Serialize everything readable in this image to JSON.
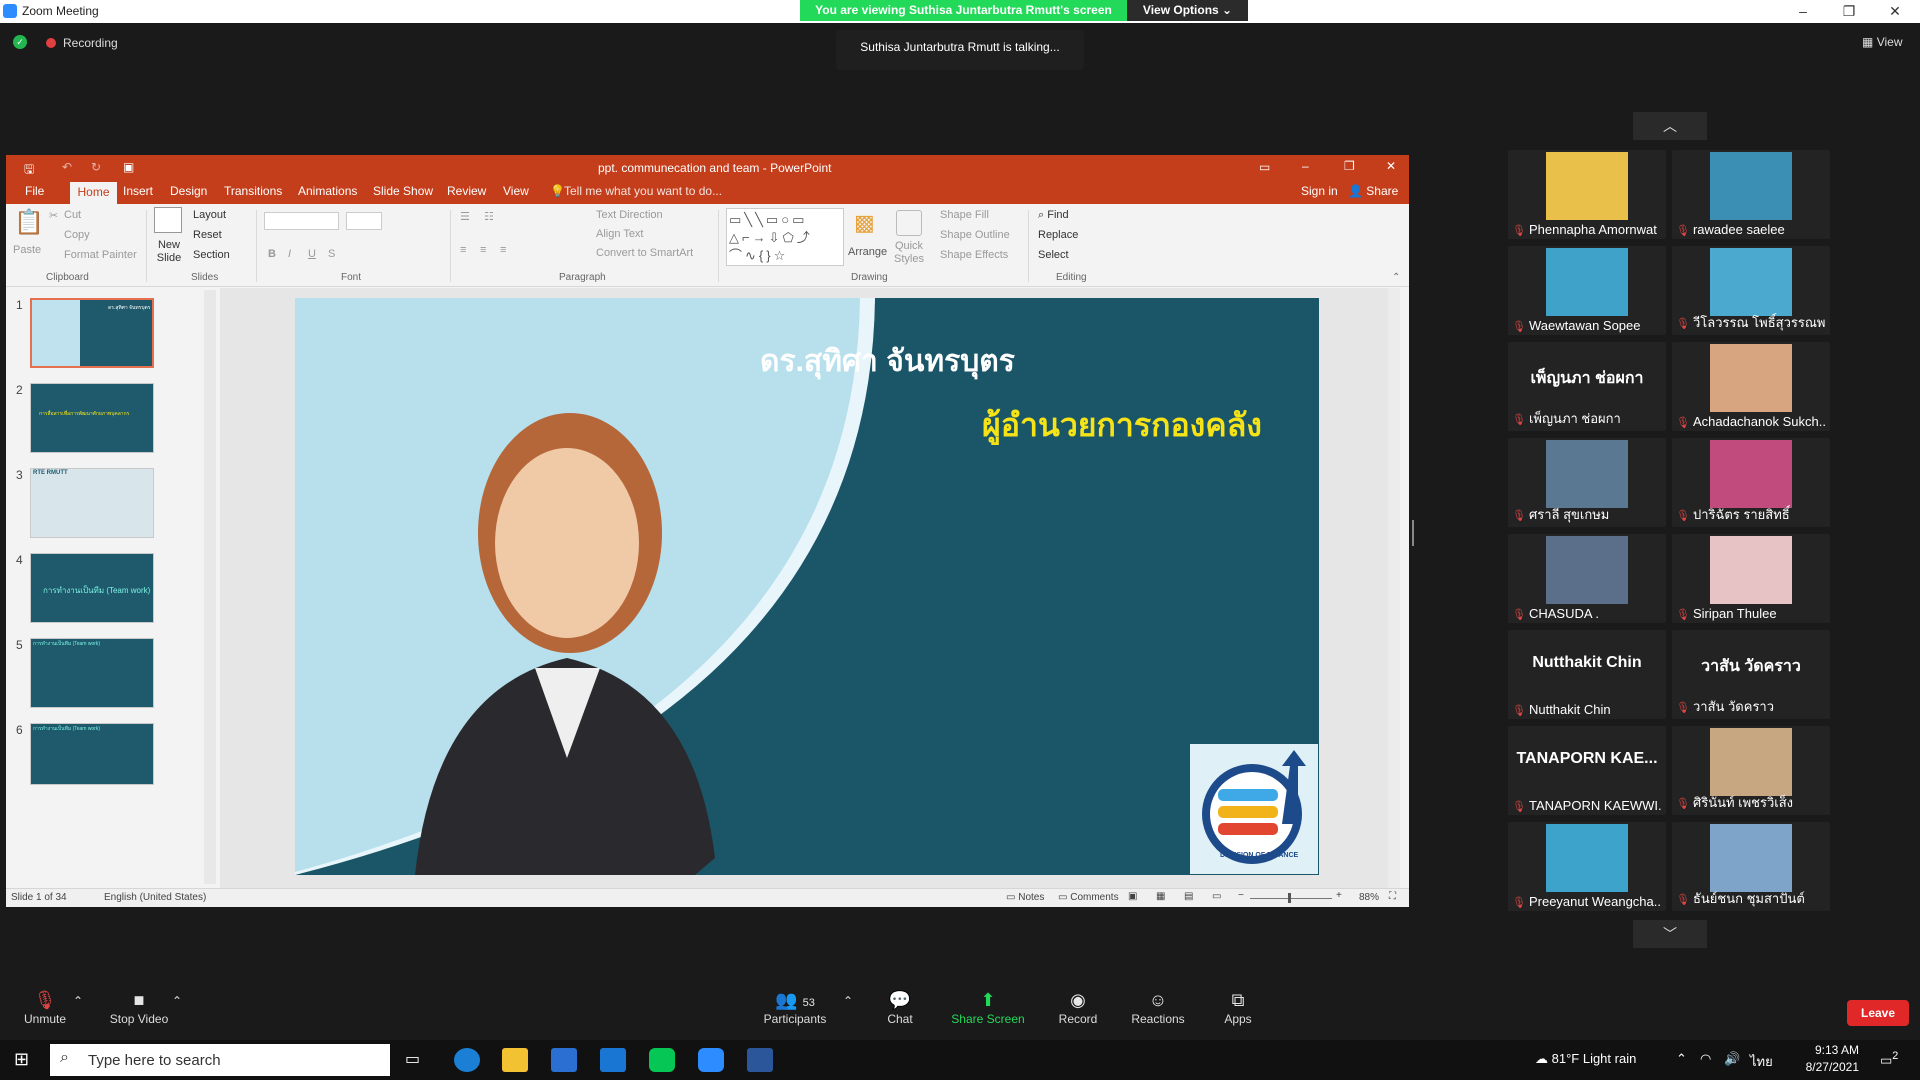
{
  "window": {
    "title": "Zoom Meeting"
  },
  "banner": {
    "viewing": "You are viewing Suthisa  Juntarbutra Rmutt's screen",
    "view_options": "View Options"
  },
  "talking": "Suthisa  Juntarbutra Rmutt is talking...",
  "recording": "Recording",
  "view_label": "View",
  "ppt": {
    "title": "ppt. communecation and team  -  PowerPoint",
    "tabs": [
      "File",
      "Home",
      "Insert",
      "Design",
      "Transitions",
      "Animations",
      "Slide Show",
      "Review",
      "View"
    ],
    "tell_me": "Tell me what you want to do...",
    "sign_in": "Sign in",
    "share": "Share",
    "ribbon": {
      "paste": "Paste",
      "cut": "Cut",
      "copy": "Copy",
      "format_painter": "Format Painter",
      "clipboard": "Clipboard",
      "new_slide": "New Slide",
      "layout": "Layout",
      "reset": "Reset",
      "section": "Section",
      "slides": "Slides",
      "font": "Font",
      "paragraph": "Paragraph",
      "text_direction": "Text Direction",
      "align_text": "Align Text",
      "convert_smartart": "Convert to SmartArt",
      "arrange": "Arrange",
      "quick_styles": "Quick Styles",
      "shape_fill": "Shape Fill",
      "shape_outline": "Shape Outline",
      "shape_effects": "Shape Effects",
      "drawing": "Drawing",
      "find": "Find",
      "replace": "Replace",
      "select": "Select",
      "editing": "Editing"
    },
    "thumbnails": [
      {
        "num": "1",
        "text": "ดร.สุทิศา จันทรบุตร"
      },
      {
        "num": "2",
        "text": "การสื่อสารเพื่อการพัฒนาศักยภาพบุคลากร"
      },
      {
        "num": "3",
        "text": "RTE RMUTT"
      },
      {
        "num": "4",
        "text": "การทำงานเป็นทีม (Team work)"
      },
      {
        "num": "5",
        "text": "การทำงานเป็นทีม (Team work)"
      },
      {
        "num": "6",
        "text": "การทำงานเป็นทีม (Team work)"
      }
    ],
    "slide": {
      "title": "ดร.สุทิศา  จันทรบุตร",
      "subtitle": "ผู้อำนวยการกองคลัง",
      "logo_text": "DEVISION OF FINANCE"
    },
    "status": {
      "slide_of": "Slide 1 of 34",
      "language": "English (United States)",
      "notes": "Notes",
      "comments": "Comments",
      "zoom": "88%"
    }
  },
  "gallery": [
    {
      "name": "Phennapha Amornwat",
      "video": true,
      "bg": "#e9c14a"
    },
    {
      "name": "rawadee saelee",
      "video": true,
      "bg": "#3b8fb5"
    },
    {
      "name": "Waewtawan Sopee",
      "video": true,
      "bg": "#3fa2c8"
    },
    {
      "name": "วีโลวรรณ โพธิ์สุวรรณพร",
      "video": true,
      "bg": "#4ba9cf"
    },
    {
      "name": "เพ็ญนภา ช่อผกา",
      "big": "เพ็ญนภา ช่อผกา",
      "video": false
    },
    {
      "name": "Achadachanok  Sukch...",
      "video": true,
      "bg": "#d7a57f"
    },
    {
      "name": "ศราลี  สุขเกษม",
      "video": true,
      "bg": "#5a7892"
    },
    {
      "name": "ปาริฉัตร  รายสิทธิ์",
      "video": true,
      "bg": "#c24b7e"
    },
    {
      "name": "CHASUDA .",
      "video": true,
      "bg": "#5b6e8a"
    },
    {
      "name": "Siripan Thulee",
      "video": true,
      "bg": "#e7c3c6"
    },
    {
      "name": "Nutthakit Chin",
      "big": "Nutthakit Chin",
      "video": false
    },
    {
      "name": "วาสัน  วัดคราว",
      "big": "วาสัน  วัดคราว",
      "video": false
    },
    {
      "name": "TANAPORN KAEWWI...",
      "big": "TANAPORN  KAE...",
      "video": false
    },
    {
      "name": "ศิรินันท์ เพชรวิเส็ง",
      "video": true,
      "bg": "#c7a782"
    },
    {
      "name": "Preeyanut Weangcha...",
      "video": true,
      "bg": "#3ea3cb"
    },
    {
      "name": "ธันย์ชนก ชุมสาปันต์",
      "video": true,
      "bg": "#7fa4c9"
    }
  ],
  "toolbar": {
    "unmute": "Unmute",
    "stop_video": "Stop Video",
    "participants": "Participants",
    "participants_count": "53",
    "chat": "Chat",
    "share_screen": "Share Screen",
    "record": "Record",
    "reactions": "Reactions",
    "apps": "Apps",
    "leave": "Leave"
  },
  "taskbar": {
    "search": "Type here to search",
    "weather": "81°F  Light rain",
    "lang": "ไทย",
    "time": "9:13 AM",
    "date": "8/27/2021",
    "notif": "2"
  }
}
